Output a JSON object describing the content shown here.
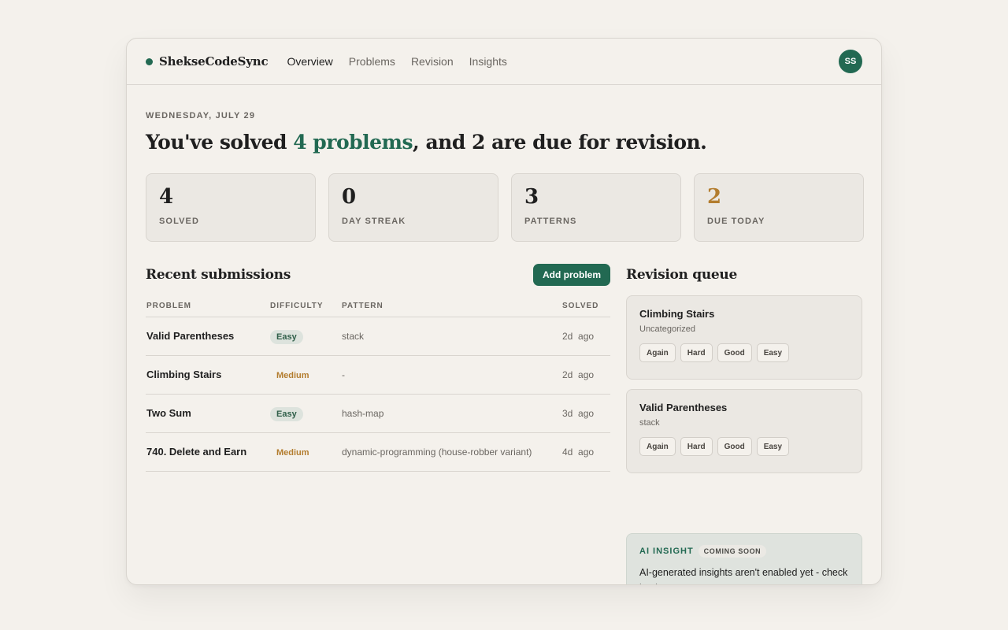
{
  "brand": {
    "name": "ShekseCodeSync"
  },
  "nav": {
    "links": [
      {
        "label": "Overview",
        "active": true
      },
      {
        "label": "Problems",
        "active": false
      },
      {
        "label": "Revision",
        "active": false
      },
      {
        "label": "Insights",
        "active": false
      }
    ],
    "avatar_initials": "SS"
  },
  "header": {
    "date": "WEDNESDAY, JULY 29",
    "headline_pre": "You've solved ",
    "headline_accent": "4 problems",
    "headline_post": ", and 2 are due for revision."
  },
  "stats": [
    {
      "value": "4",
      "label": "SOLVED"
    },
    {
      "value": "0",
      "label": "DAY STREAK"
    },
    {
      "value": "3",
      "label": "PATTERNS"
    },
    {
      "value": "2",
      "label": "DUE TODAY"
    }
  ],
  "recent": {
    "title": "Recent submissions",
    "add_label": "Add problem",
    "columns": [
      "PROBLEM",
      "DIFFICULTY",
      "PATTERN",
      "SOLVED"
    ],
    "rows": [
      {
        "problem": "Valid Parentheses",
        "difficulty": "Easy",
        "pattern": "stack",
        "solved": "2d  ago"
      },
      {
        "problem": "Climbing Stairs",
        "difficulty": "Medium",
        "pattern": "-",
        "solved": "2d  ago"
      },
      {
        "problem": "Two Sum",
        "difficulty": "Easy",
        "pattern": "hash-map",
        "solved": "3d  ago"
      },
      {
        "problem": "740. Delete and Earn",
        "difficulty": "Medium",
        "pattern": "dynamic-programming (house-robber variant)",
        "solved": "4d  ago"
      }
    ]
  },
  "revision": {
    "title": "Revision queue",
    "cards": [
      {
        "name": "Climbing Stairs",
        "sub": "Uncategorized"
      },
      {
        "name": "Valid Parentheses",
        "sub": "stack"
      }
    ],
    "ratings": [
      "Again",
      "Hard",
      "Good",
      "Easy"
    ]
  },
  "insight": {
    "label": "AI INSIGHT",
    "badge": "COMING SOON",
    "text": "AI-generated insights aren't enabled yet - check back soon."
  },
  "colors": {
    "accent": "#226952",
    "warning": "#b37d2f",
    "background": "#f4f1ec"
  }
}
